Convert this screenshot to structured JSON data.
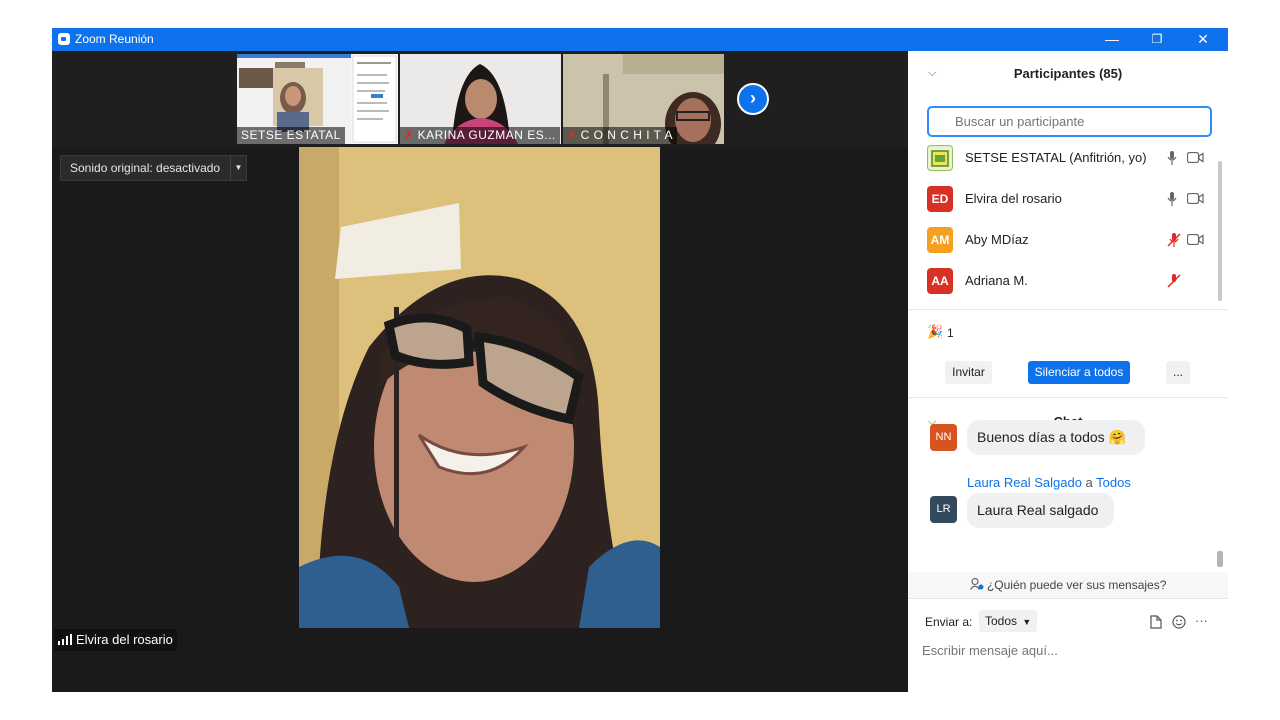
{
  "window": {
    "title": "Zoom Reunión",
    "minimize_label": "—",
    "restore_label": "❐",
    "close_label": "✕"
  },
  "gallery": {
    "thumbnails": [
      {
        "name": "SETSE ESTATAL",
        "muted": false
      },
      {
        "name": "KARINA GUZMAN ES...",
        "muted": true
      },
      {
        "name": "C O N C H I T A",
        "muted": true
      }
    ],
    "next_label": "›"
  },
  "original_sound": {
    "label": "Sonido original: desactivado",
    "dropdown_label": "▼"
  },
  "active_speaker": {
    "name": "Elvira del rosario"
  },
  "participants_panel": {
    "title": "Participantes (85)",
    "search_placeholder": "Buscar un participante",
    "participants": [
      {
        "initials": "",
        "name": "SETSE ESTATAL (Anfitrión, yo)",
        "avatar_color": "#e9f2cf",
        "muted": false
      },
      {
        "initials": "ED",
        "name": "Elvira del rosario",
        "avatar_color": "#d93025",
        "muted": false
      },
      {
        "initials": "AM",
        "name": "Aby MDíaz",
        "avatar_color": "#f4a021",
        "muted": true
      },
      {
        "initials": "AA",
        "name": "Adriana M.",
        "avatar_color": "#d93025",
        "muted": true
      }
    ],
    "reactions": {
      "icon": "🎉",
      "count": "1"
    },
    "invite_label": "Invitar",
    "mute_all_label": "Silenciar a todos",
    "more_label": "..."
  },
  "chat": {
    "title": "Chat",
    "messages": [
      {
        "initials": "NN",
        "avatar_color": "#d9531e",
        "text": "Buenos días a todos",
        "emoji": "🤗"
      },
      {
        "initials": "LR",
        "avatar_color": "#34495e",
        "sender": "Laura Real Salgado",
        "connector": "a",
        "recipient": "Todos",
        "text": "Laura Real salgado"
      }
    ],
    "visibility_text": "¿Quién puede ver sus mensajes?",
    "send_to_label": "Enviar a:",
    "send_to_value": "Todos",
    "input_placeholder": "Escribir mensaje aquí...",
    "more_label": "···"
  },
  "colors": {
    "zoom_blue": "#0e72ed",
    "muted_red": "#e02828"
  }
}
